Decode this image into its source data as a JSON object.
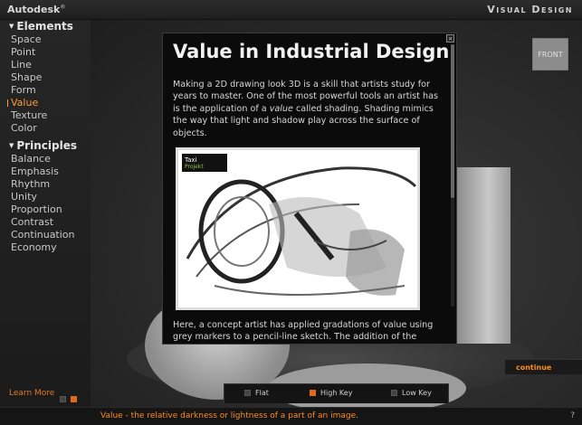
{
  "topbar": {
    "brand": "Autodesk",
    "brand_mark": "®",
    "title": "Visual Design"
  },
  "sidebar": {
    "elements_heading": "Elements",
    "elements": [
      "Space",
      "Point",
      "Line",
      "Shape",
      "Form",
      "Value",
      "Texture",
      "Color"
    ],
    "active": "Value",
    "principles_heading": "Principles",
    "principles": [
      "Balance",
      "Emphasis",
      "Rhythm",
      "Unity",
      "Proportion",
      "Contrast",
      "Continuation",
      "Economy"
    ],
    "learn_more": "Learn More"
  },
  "stage": {
    "front_label": "FRONT"
  },
  "popup": {
    "title": "Value in Industrial Design",
    "para1_pre": "Making a 2D drawing look 3D is a skill that artists study for years to master. One of the most powerful tools an artist has is the application of a ",
    "para1_em": "value",
    "para1_post": " called shading. Shading mimics the way that light and shadow play across the surface of objects.",
    "logo_line1": "Taxi",
    "logo_line2": "Projekt",
    "para2": "Here, a concept artist has applied gradations of value using grey markers to a pencil-line sketch. The addition of the",
    "close_glyph": "×"
  },
  "continue_label": "continue",
  "modes": [
    {
      "label": "Flat",
      "active": false
    },
    {
      "label": "High Key",
      "active": true
    },
    {
      "label": "Low Key",
      "active": false
    }
  ],
  "bottom": {
    "definition": "Value - the relative darkness or lightness of a part of an image.",
    "help": "?"
  },
  "colors": {
    "accent": "#ff8c1a",
    "background": "#2a2a2a"
  }
}
